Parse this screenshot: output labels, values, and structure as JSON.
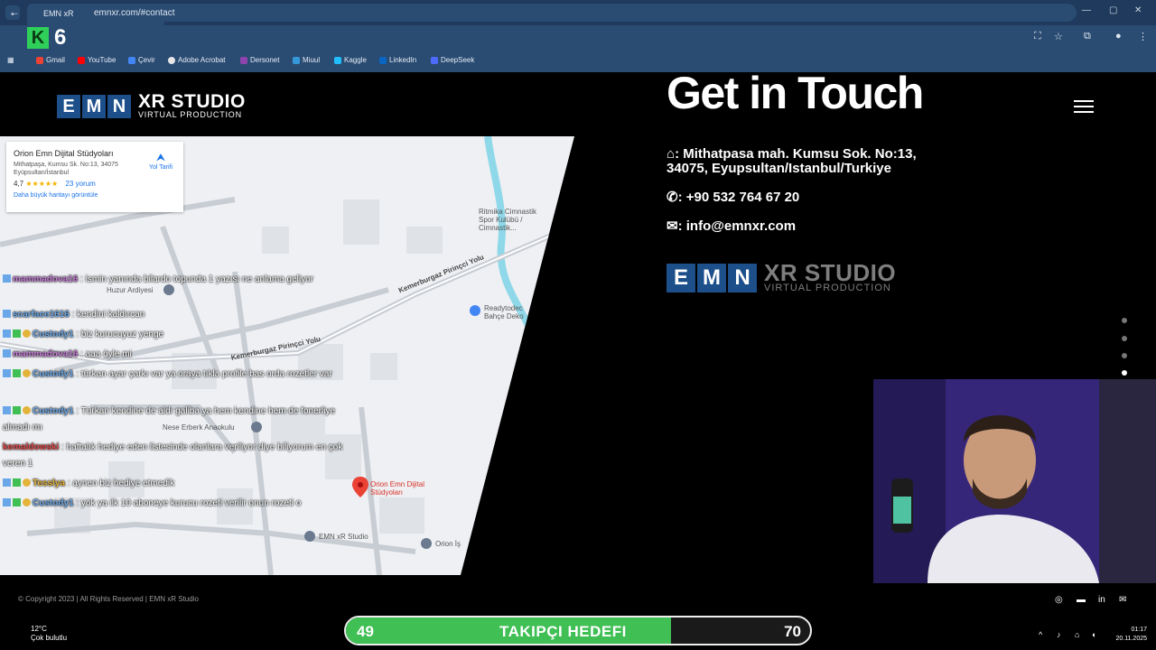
{
  "browser": {
    "tab_title": "EMN xR Studio",
    "url": "emnxr.com/#contact",
    "bookmarks": [
      {
        "label": "Gmail",
        "color": "#ea4335"
      },
      {
        "label": "YouTube",
        "color": "#ff0000"
      },
      {
        "label": "Çevir",
        "color": "#4285f4"
      },
      {
        "label": "Adobe Acrobat",
        "color": "#e7e7e7"
      },
      {
        "label": "Dersonet",
        "color": "#8e44ad"
      },
      {
        "label": "Miuul",
        "color": "#3498db"
      },
      {
        "label": "Kaggle",
        "color": "#20beff"
      },
      {
        "label": "LinkedIn",
        "color": "#0a66c2"
      },
      {
        "label": "DeepSeek",
        "color": "#4d6bfe"
      }
    ]
  },
  "overlay_badge": {
    "letter": "K",
    "number": "6"
  },
  "site": {
    "logo": {
      "boxes": [
        "E",
        "M",
        "N"
      ],
      "title": "XR STUDIO",
      "subtitle": "VIRTUAL PRODUCTION"
    },
    "heading": "Get in Touch",
    "address": ": Mithatpasa mah. Kumsu Sok. No:13, 34075, Eyupsultan/Istanbul/Turkiye",
    "phone": ": +90 532 764 67 20",
    "email": ": info@emnxr.com",
    "copyright": "© Copyright 2023 | All Rights Reserved | EMN xR Studio"
  },
  "map": {
    "card_title": "Orion Emn Dijital Stüdyoları",
    "card_address": "Mithatpaşa, Kumsu Sk. No:13, 34075 Eyüpsultan/İstanbul",
    "rating": "4,7",
    "stars": "★★★★★",
    "reviews": "23 yorum",
    "directions": "Yol Tarifi",
    "larger_map": "Daha büyük haritayı görüntüle",
    "labels": {
      "sport_club": "Ritmika Cimnastik Spor Kulübü / Cimnastik...",
      "kindergarten_top": "Huzur Ardiyesi",
      "street_1": "Kemerburgaz Pirinçci Yolu",
      "street_2": "Kemerburgaz Pirinçci Yolu",
      "readytodec": "Readytodec Bahçe Deko",
      "anaokulu": "Nese Erberk Anaokulu",
      "pin_name": "Orion Emn Dijital Stüdyoları",
      "emn_studio": "EMN xR Studio",
      "orion_is": "Orion İş"
    }
  },
  "chat": [
    {
      "user": "mammadova16",
      "color": "pink",
      "text": ": ismin yanında bilardo topunda 1 yazısı ne anlama geliyor"
    },
    {
      "user": "scarface1616",
      "color": "blue",
      "text": ": kendini kaldırcan"
    },
    {
      "user": "Custody1",
      "color": "blue",
      "text": ": biz kurucuyuz yenge"
    },
    {
      "user": "mammadova16",
      "color": "pink",
      "text": ": aaa öyle mi"
    },
    {
      "user": "Custody1",
      "color": "blue",
      "text": ": türkan ayar çarkı var ya oraya tıkla profile bas orda rozetler var"
    },
    {
      "user": "Custody1",
      "color": "blue",
      "text": ": Türkan kendine de aldı galiba ya hem kendine hem de fonerliye almadı mı"
    },
    {
      "user": "kemaldowski",
      "color": "red",
      "text": ": haftalık hediye eden listesinde olanlara veriliyor diye biliyorum en çok veren 1"
    },
    {
      "user": "Tesslya",
      "color": "yellow",
      "text": ": aynen biz hediye etmedik"
    },
    {
      "user": "Custody1",
      "color": "blue",
      "text": ": yok ya ilk 10 aboneye kurucu rozeti verilir onun rozeti o"
    }
  ],
  "goal": {
    "current": "49",
    "label": "TAKIPÇI HEDEFI",
    "target": "70",
    "progress": 0.7
  },
  "taskbar": {
    "temperature": "12°C",
    "weather": "Çok bulutlu",
    "time": "01:17",
    "date": "20.11.2025"
  },
  "colors": {
    "accent": "#1d4f8a",
    "goal_fill": "#3fbf54"
  }
}
